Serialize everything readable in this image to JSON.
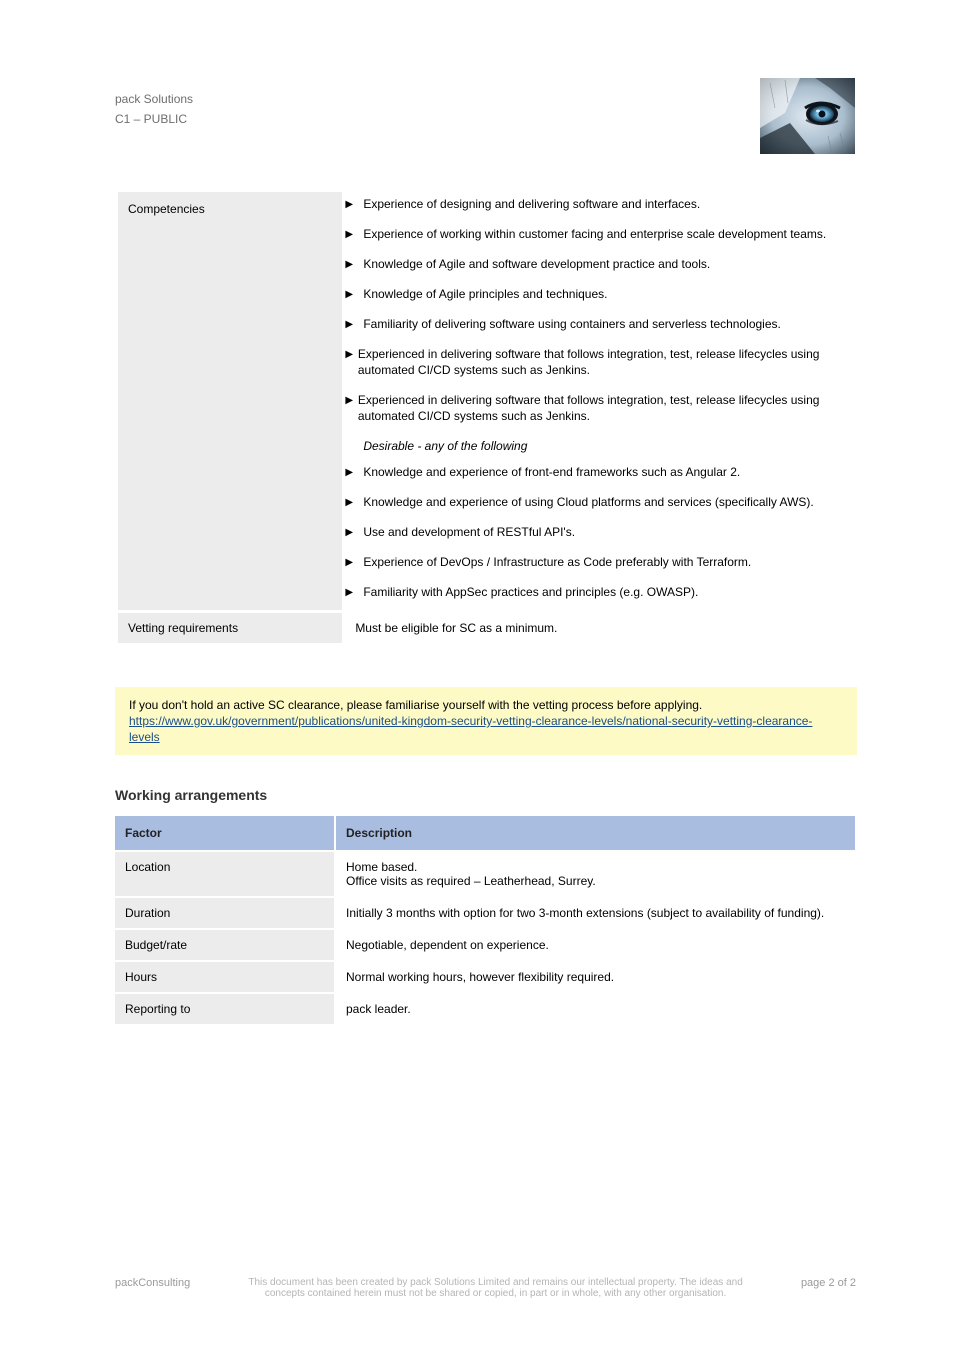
{
  "header": {
    "title": "pack Solutions",
    "subtitle": "C1 – PUBLIC"
  },
  "wolf_icon": "wolf-eye-icon",
  "t1": {
    "r1_left": "Competencies",
    "r1_bullets": [
      "Experience of designing and delivering software and interfaces.",
      "Experience of working within customer facing and enterprise scale development teams.",
      "Knowledge of Agile and software development practice and tools.",
      "Knowledge of Agile principles and techniques.",
      "Familiarity of delivering software using containers and serverless technologies.",
      "Experienced in delivering software that follows integration, test, release lifecycles using automated CI/CD systems such as Jenkins.",
      "Experienced in delivering software that follows integration, test, release lifecycles using automated CI/CD systems such as Jenkins."
    ],
    "r1_bullets_gray_label": "Desirable - any of the following",
    "r1_bullets2": [
      "Knowledge and experience of front-end frameworks such as Angular 2.",
      "Knowledge and experience of using Cloud platforms and services (specifically AWS).",
      "Use and development of RESTful API's.",
      "Experience of DevOps / Infrastructure as Code preferably with Terraform.",
      "Familiarity with AppSec practices and principles (e.g. OWASP)."
    ],
    "r2_left": "Vetting requirements",
    "r2_right": "Must be eligible for SC as a minimum."
  },
  "note": {
    "pre": "If you don't hold an active SC clearance, please familiarise yourself with the vetting process before applying.",
    "link_text": "https://www.gov.uk/government/publications/united-kingdom-security-vetting-clearance-levels/national-security-vetting-clearance-levels",
    "link_href": "#"
  },
  "h2": "Working arrangements",
  "t2": {
    "col1": "Factor",
    "col2": "Description",
    "rows": [
      [
        "Location",
        "Home based.\nOffice visits as required – Leatherhead, Surrey."
      ],
      [
        "Duration",
        "Initially 3 months with option for two 3-month extensions (subject to availability of funding)."
      ],
      [
        "Budget/rate",
        "Negotiable, dependent on experience."
      ],
      [
        "Hours",
        "Normal working hours, however flexibility required."
      ],
      [
        "Reporting to",
        "pack leader."
      ]
    ]
  },
  "footer": {
    "left": "packConsulting",
    "center": "This document has been created by pack Solutions Limited and remains our intellectual property. The ideas and concepts contained herein must not be shared or copied, in part or in whole, with any other organisation.",
    "right": "page 2 of 2"
  }
}
